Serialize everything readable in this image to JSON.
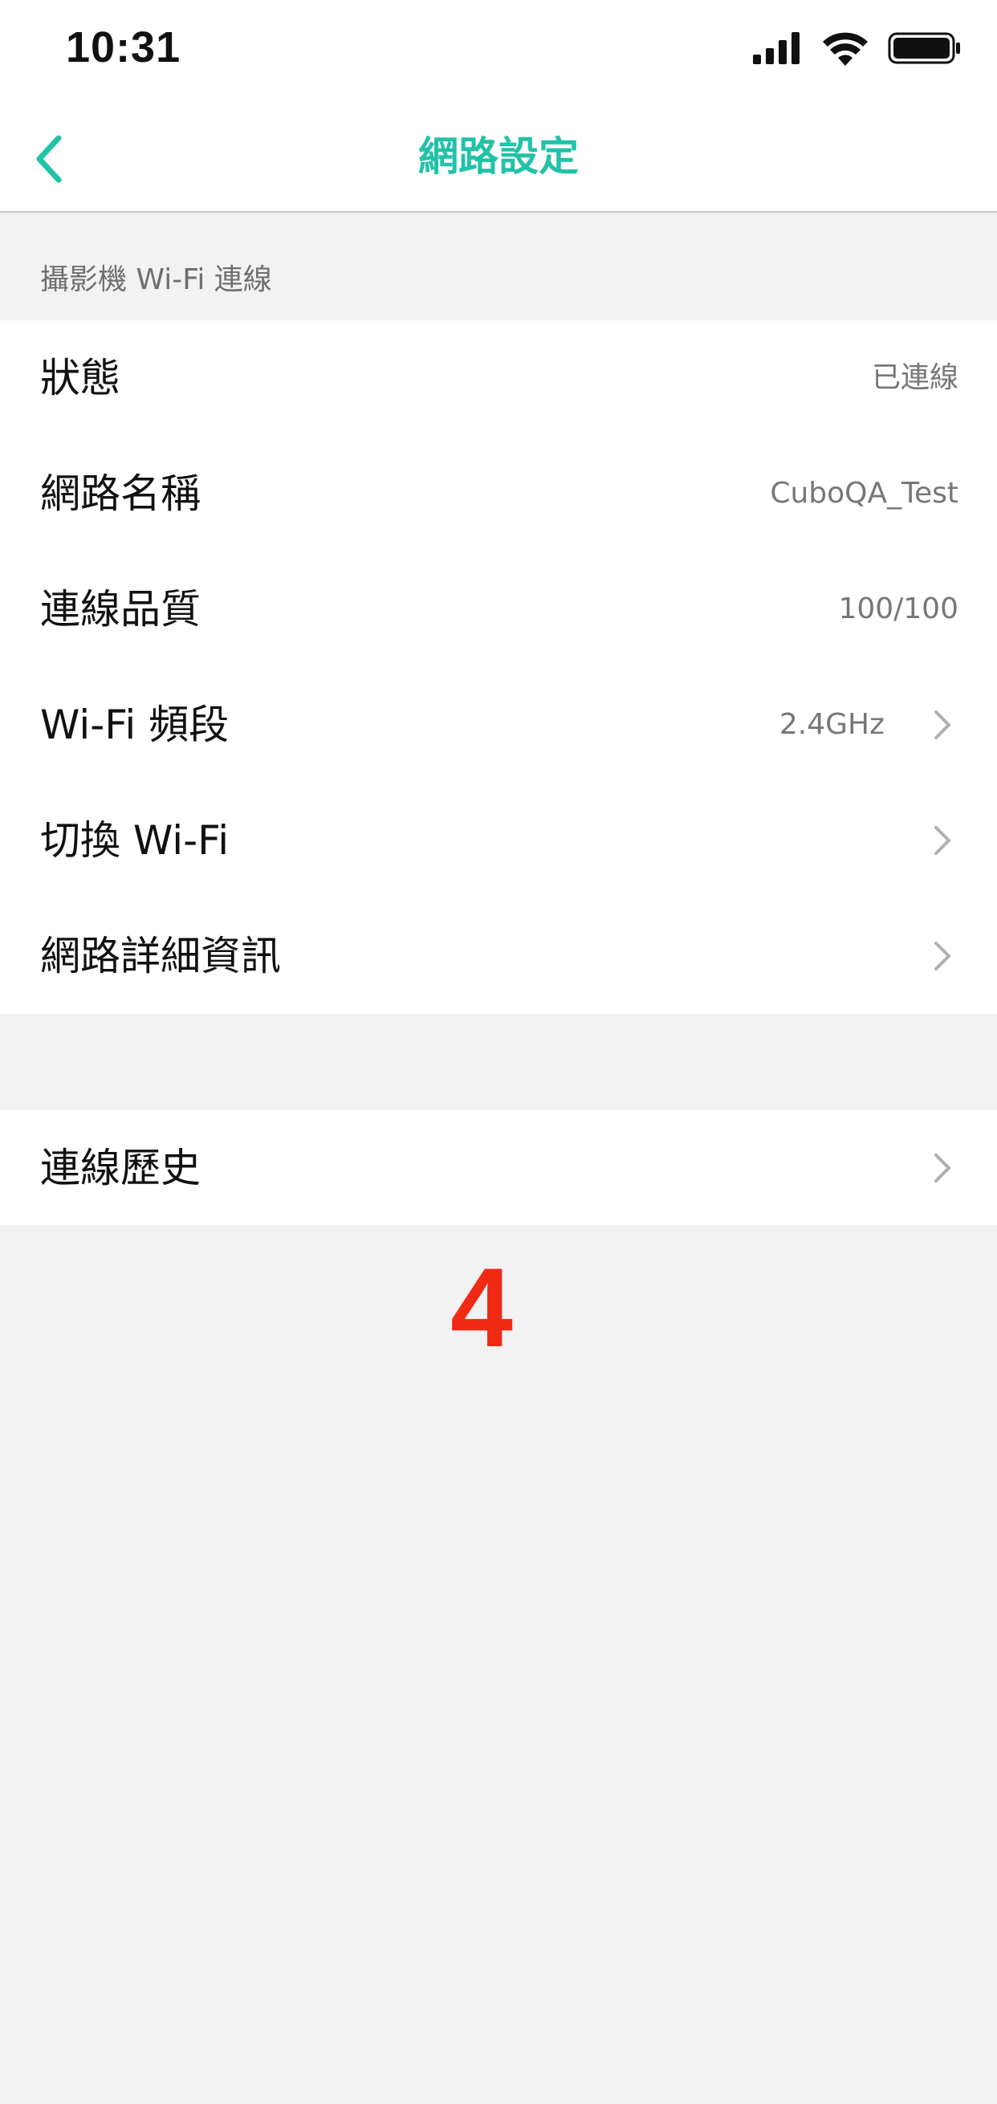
{
  "status_bar": {
    "time": "10:31",
    "icons": [
      "signal-icon",
      "wifi-icon",
      "battery-icon"
    ]
  },
  "nav": {
    "title": "網路設定",
    "back_icon": "chevron-left-icon",
    "accent_color": "#22c2a8"
  },
  "section": {
    "header": "攝影機 Wi-Fi 連線",
    "rows": [
      {
        "label": "狀態",
        "value": "已連線",
        "chevron": false
      },
      {
        "label": "網路名稱",
        "value": "CuboQA_Test",
        "chevron": false
      },
      {
        "label": "連線品質",
        "value": "100/100",
        "chevron": false
      },
      {
        "label": "Wi-Fi 頻段",
        "value": "2.4GHz",
        "chevron": true
      },
      {
        "label": "切換 Wi-Fi",
        "value": "",
        "chevron": true
      },
      {
        "label": "網路詳細資訊",
        "value": "",
        "chevron": true
      }
    ]
  },
  "history": {
    "label": "連線歷史",
    "chevron": true
  },
  "annotation": {
    "number": "4",
    "color": "#f02a14"
  }
}
